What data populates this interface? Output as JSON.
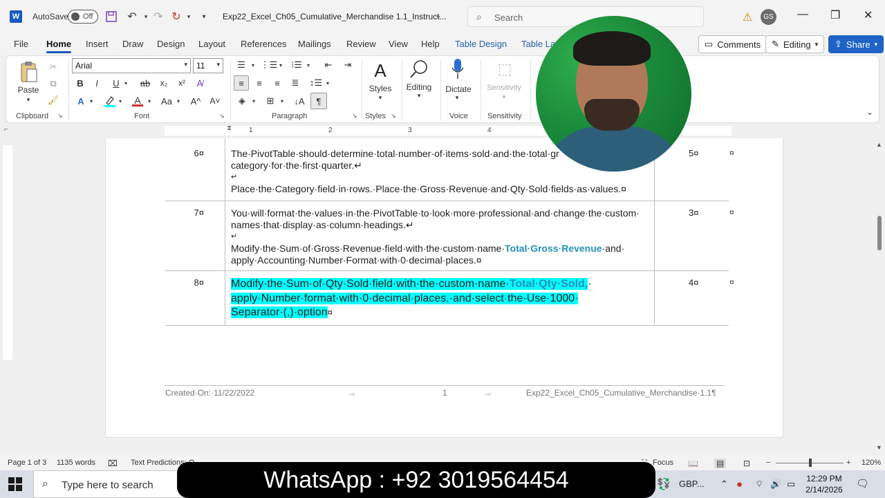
{
  "titlebar": {
    "app_letter": "W",
    "autosave_label": "AutoSave",
    "autosave_state": "Off",
    "doc_title": "Exp22_Excel_Ch05_Cumulative_Merchandise 1.1_Instruct...",
    "search_placeholder": "Search",
    "user_initials": "GS"
  },
  "tabs": [
    "File",
    "Home",
    "Insert",
    "Draw",
    "Design",
    "Layout",
    "References",
    "Mailings",
    "Review",
    "View",
    "Help",
    "Table Design",
    "Table La"
  ],
  "active_tab": "Home",
  "actions": {
    "comments": "Comments",
    "editing": "Editing",
    "share": "Share"
  },
  "ribbon": {
    "clipboard": {
      "paste": "Paste",
      "label": "Clipboard"
    },
    "font": {
      "name": "Arial",
      "size": "11",
      "label": "Font"
    },
    "paragraph": {
      "label": "Paragraph"
    },
    "styles": {
      "button": "Styles",
      "label": "Styles"
    },
    "editing": {
      "button": "Editing"
    },
    "voice": {
      "button": "Dictate",
      "label": "Voice"
    },
    "sensitivity": {
      "button": "Sensitivity",
      "label": "Sensitivity"
    }
  },
  "ruler_numbers": [
    "1",
    "2",
    "3",
    "4"
  ],
  "table_rows": [
    {
      "num": "6¤",
      "line1": "The·PivotTable·should·determine·total·number·of·items·sold·and·the·total·gr",
      "line2": "category·for·the·first·quarter.↵",
      "line3": "↵",
      "line4": "Place·the·Category·field·in·rows.·Place·the·Gross·Revenue·and·Qty·Sold·fields·as·values.¤",
      "points": "5¤",
      "end": "¤"
    },
    {
      "num": "7¤",
      "line1": "You·will·format·the·values·in·the·PivotTable·to·look·more·professional·and·change·the·custom·",
      "line2": "names·that·display·as·column·headings.↵",
      "line3": "↵",
      "line4_pre": "Modify·the·Sum·of·Gross·Revenue·field·with·the·custom·name·",
      "line4_kw": "Total·Gross·Revenue",
      "line4_post": "·and·",
      "line5": "apply·Accounting·Number·Format·with·0·decimal·places.¤",
      "points": "3¤",
      "end": "¤"
    },
    {
      "num": "8¤",
      "line1_pre": "Modify·the·Sum·of·Qty·Sold·field·with·the·custom·name·",
      "line1_kw": "Total·Qty·Sold,",
      "line1_post": "·",
      "line2": "apply·Number·format·with·0·decimal·places,·and·select·the·Use·1000·",
      "line3": "Separator·(,)·option",
      "line3_end": "¤",
      "points": "4¤",
      "end": "¤"
    }
  ],
  "footer": {
    "created": "Created·On:·11/22/2022",
    "arrow1": "→",
    "page": "1",
    "arrow2": "→",
    "file": "Exp22_Excel_Ch05_Cumulative_Merchandise·1.1¶"
  },
  "statusbar": {
    "page": "Page 1 of 3",
    "words": "1135 words",
    "predictions": "Text Predictions: O",
    "focus": "Focus",
    "zoom": "120%"
  },
  "taskbar": {
    "search": "Type here to search",
    "tray_app": "GBP...",
    "time": "12:29 PM",
    "date": "2/14/2026"
  },
  "overlay": {
    "banner": "WhatsApp : +92 3019564454"
  }
}
